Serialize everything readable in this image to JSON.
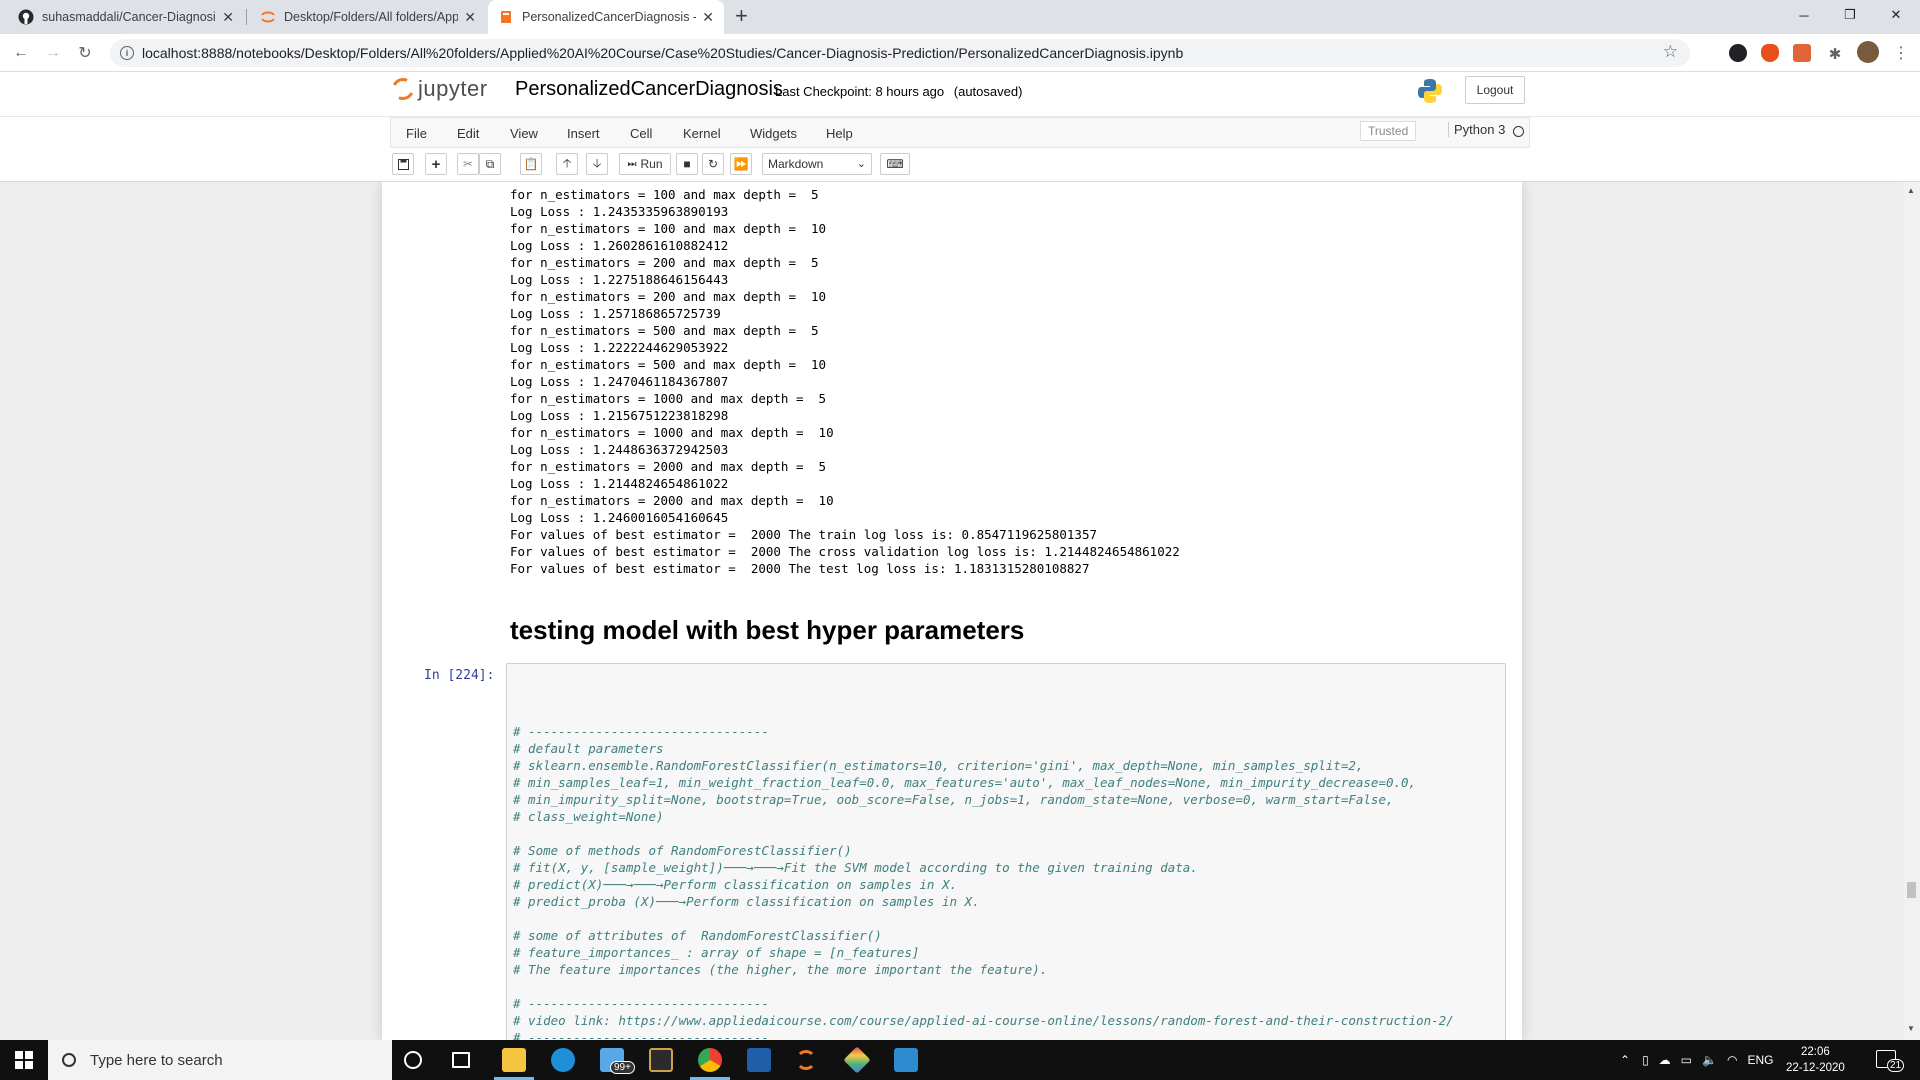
{
  "browser": {
    "tabs": [
      {
        "title": "suhasmaddali/Cancer-Diagnosis-",
        "icon": "github-icon"
      },
      {
        "title": "Desktop/Folders/All folders/Appl",
        "icon": "jupyter-icon"
      },
      {
        "title": "PersonalizedCancerDiagnosis - Ju",
        "icon": "jupyter-notebook-icon"
      }
    ],
    "url": "localhost:8888/notebooks/Desktop/Folders/All%20folders/Applied%20AI%20Course/Case%20Studies/Cancer-Diagnosis-Prediction/PersonalizedCancerDiagnosis.ipynb"
  },
  "jupyter": {
    "logo_text": "jupyter",
    "notebook_name": "PersonalizedCancerDiagnosis",
    "checkpoint_label": "Last Checkpoint:",
    "checkpoint_time": "8 hours ago",
    "autosave": "(autosaved)",
    "logout": "Logout",
    "menu": [
      "File",
      "Edit",
      "View",
      "Insert",
      "Cell",
      "Kernel",
      "Widgets",
      "Help"
    ],
    "trusted": "Trusted",
    "kernel": "Python 3",
    "run_label": "Run",
    "cell_type": "Markdown"
  },
  "notebook": {
    "output_lines": [
      "for n_estimators = 100 and max depth =  5",
      "Log Loss : 1.2435335963890193",
      "for n_estimators = 100 and max depth =  10",
      "Log Loss : 1.2602861610882412",
      "for n_estimators = 200 and max depth =  5",
      "Log Loss : 1.2275188646156443",
      "for n_estimators = 200 and max depth =  10",
      "Log Loss : 1.257186865725739",
      "for n_estimators = 500 and max depth =  5",
      "Log Loss : 1.2222244629053922",
      "for n_estimators = 500 and max depth =  10",
      "Log Loss : 1.2470461184367807",
      "for n_estimators = 1000 and max depth =  5",
      "Log Loss : 1.2156751223818298",
      "for n_estimators = 1000 and max depth =  10",
      "Log Loss : 1.2448636372942503",
      "for n_estimators = 2000 and max depth =  5",
      "Log Loss : 1.2144824654861022",
      "for n_estimators = 2000 and max depth =  10",
      "Log Loss : 1.2460016054160645",
      "For values of best estimator =  2000 The train log loss is: 0.8547119625801357",
      "For values of best estimator =  2000 The cross validation log loss is: 1.2144824654861022",
      "For values of best estimator =  2000 The test log loss is: 1.1831315280108827"
    ],
    "heading": "testing model with best hyper parameters",
    "prompt": "In [224]:",
    "code_lines": [
      "# --------------------------------",
      "# default parameters",
      "# sklearn.ensemble.RandomForestClassifier(n_estimators=10, criterion='gini', max_depth=None, min_samples_split=2,",
      "# min_samples_leaf=1, min_weight_fraction_leaf=0.0, max_features='auto', max_leaf_nodes=None, min_impurity_decrease=0.0,",
      "# min_impurity_split=None, bootstrap=True, oob_score=False, n_jobs=1, random_state=None, verbose=0, warm_start=False,",
      "# class_weight=None)",
      "",
      "# Some of methods of RandomForestClassifier()",
      "# fit(X, y, [sample_weight])\t\tFit the SVM model according to the given training data.",
      "# predict(X)\t\tPerform classification on samples in X.",
      "# predict_proba (X)\tPerform classification on samples in X.",
      "",
      "# some of attributes of  RandomForestClassifier()",
      "# feature_importances_ : array of shape = [n_features]",
      "# The feature importances (the higher, the more important the feature).",
      "",
      "# --------------------------------",
      "# video link: https://www.appliedaicourse.com/course/applied-ai-course-online/lessons/random-forest-and-their-construction-2/",
      "# --------------------------------"
    ]
  },
  "taskbar": {
    "search_placeholder": "Type here to search",
    "language": "ENG",
    "time": "22:06",
    "date": "22-12-2020",
    "notification_count": "21",
    "mail_badge": "99+"
  },
  "colors": {
    "jupyter_orange": "#f37726",
    "prompt_blue": "#303f9f",
    "comment_green": "#408080"
  }
}
